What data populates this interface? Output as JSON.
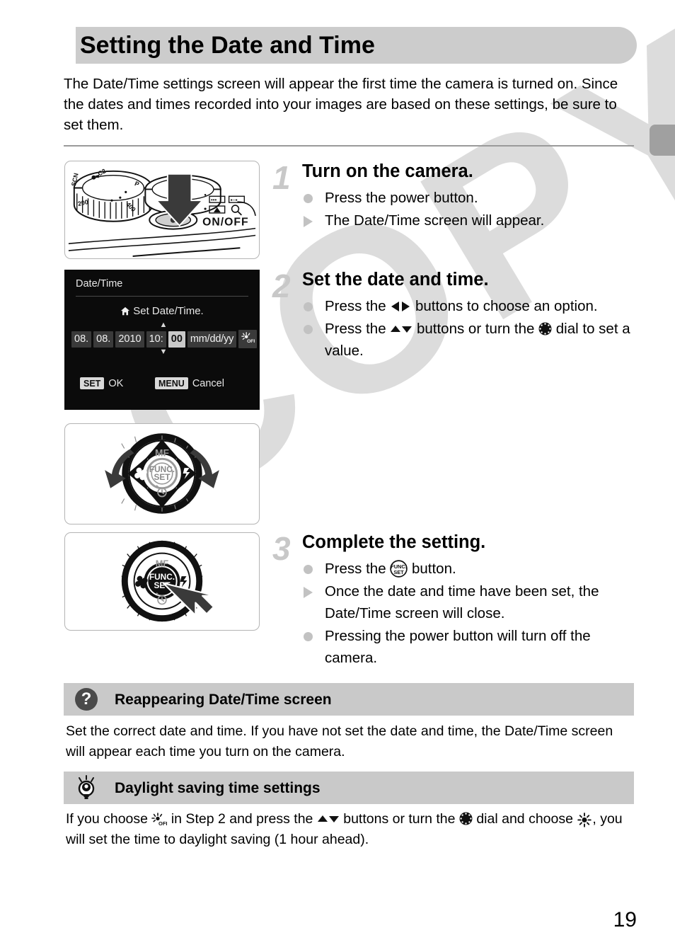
{
  "page": {
    "title": "Setting the Date and Time",
    "intro": "The Date/Time settings screen will appear the first time the camera is turned on. Since the dates and times recorded into your images are based on these settings, be sure to set them.",
    "number": "19",
    "watermark": "COPY",
    "accent_gray": "#c9c9c9",
    "header_bg": "#cccccc",
    "bullet_gray": "#c2c2c2",
    "step_num_gray": "#c8c8c8"
  },
  "lcd": {
    "title": "Date/Time",
    "subtitle": "Set Date/Time.",
    "home_icon": "home-icon",
    "fields": [
      {
        "name": "month",
        "value": "08."
      },
      {
        "name": "day",
        "value": "08."
      },
      {
        "name": "year",
        "value": "2010"
      },
      {
        "name": "hour",
        "value": "10:"
      },
      {
        "name": "minute",
        "value": "00",
        "selected": true
      },
      {
        "name": "format",
        "value": "mm/dd/yy"
      }
    ],
    "dst_icon": "sun-off-icon",
    "caret_up": "▲",
    "caret_down": "▼",
    "footer": {
      "set_key": "SET",
      "set_label": "OK",
      "menu_key": "MENU",
      "menu_label": "Cancel"
    }
  },
  "figures": [
    {
      "name": "camera-top-power-button",
      "caption_in_art": "ON/OFF",
      "dial_marks": [
        "SCN",
        "C2",
        "P",
        "200",
        "400"
      ]
    },
    {
      "name": "control-dial-rotate",
      "labels": [
        "MF",
        "FUNC.",
        "SET"
      ]
    },
    {
      "name": "func-set-button-press",
      "labels": [
        "MF",
        "FUNC.",
        "SET"
      ]
    }
  ],
  "steps": [
    {
      "number": "1",
      "heading": "Turn on the camera.",
      "lines": [
        {
          "marker": "dot",
          "parts": [
            {
              "t": "text",
              "v": "Press the power button."
            }
          ]
        },
        {
          "marker": "tri",
          "parts": [
            {
              "t": "text",
              "v": "The Date/Time screen will appear."
            }
          ]
        }
      ]
    },
    {
      "number": "2",
      "heading": "Set the date and time.",
      "lines": [
        {
          "marker": "dot",
          "parts": [
            {
              "t": "text",
              "v": "Press the "
            },
            {
              "t": "icon",
              "v": "left-right-arrows-icon"
            },
            {
              "t": "text",
              "v": " buttons to choose an option."
            }
          ]
        },
        {
          "marker": "dot",
          "parts": [
            {
              "t": "text",
              "v": "Press the "
            },
            {
              "t": "icon",
              "v": "up-down-arrows-icon"
            },
            {
              "t": "text",
              "v": " buttons or turn the "
            },
            {
              "t": "icon",
              "v": "control-dial-icon"
            },
            {
              "t": "text",
              "v": " dial to set a value."
            }
          ]
        }
      ]
    },
    {
      "number": "3",
      "heading": "Complete the setting.",
      "lines": [
        {
          "marker": "dot",
          "parts": [
            {
              "t": "text",
              "v": "Press the "
            },
            {
              "t": "icon",
              "v": "func-set-button-icon"
            },
            {
              "t": "text",
              "v": " button."
            }
          ]
        },
        {
          "marker": "tri",
          "parts": [
            {
              "t": "text",
              "v": "Once the date and time have been set, the Date/Time screen will close."
            }
          ]
        },
        {
          "marker": "dot",
          "parts": [
            {
              "t": "text",
              "v": "Pressing the power button will turn off the camera."
            }
          ]
        }
      ]
    }
  ],
  "notes": [
    {
      "icon": "question-mark-icon",
      "title": "Reappearing Date/Time screen",
      "body_parts": [
        {
          "t": "text",
          "v": "Set the correct date and time. If you have not set the date and time, the Date/Time screen will appear each time you turn on the camera."
        }
      ]
    },
    {
      "icon": "lightbulb-icon",
      "title": "Daylight saving time settings",
      "body_parts": [
        {
          "t": "text",
          "v": "If you choose "
        },
        {
          "t": "icon",
          "v": "sun-off-icon"
        },
        {
          "t": "text",
          "v": " in Step 2 and press the "
        },
        {
          "t": "icon",
          "v": "up-down-arrows-icon"
        },
        {
          "t": "text",
          "v": " buttons or turn the "
        },
        {
          "t": "icon",
          "v": "control-dial-icon"
        },
        {
          "t": "text",
          "v": " dial and choose "
        },
        {
          "t": "icon",
          "v": "sun-on-icon"
        },
        {
          "t": "text",
          "v": ", you will set the time to daylight saving (1 hour ahead)."
        }
      ]
    }
  ]
}
